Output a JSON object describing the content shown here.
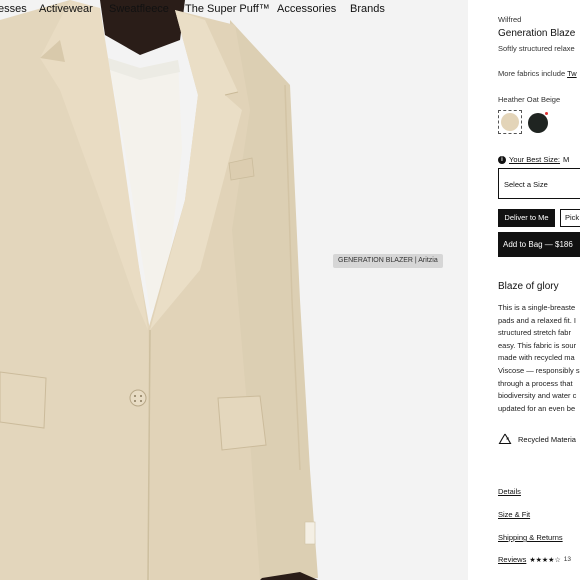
{
  "nav": {
    "items": [
      "esses",
      "Activewear",
      "Sweatfleece",
      "The Super Puff™",
      "Accessories",
      "Brands"
    ]
  },
  "image": {
    "tooltip": "GENERATION BLAZER | Aritzia"
  },
  "product": {
    "brand": "Wilfred",
    "name": "Generation Blaze",
    "subtitle": "Softly structured relaxe",
    "fabrics_prefix": "More fabrics include ",
    "fabrics_link": "Tw",
    "color_name": "Heather Oat Beige",
    "swatches": [
      {
        "name": "Heather Oat Beige",
        "color": "#e3d4b8",
        "selected": true
      },
      {
        "name": "Dark",
        "color": "#1f2421",
        "selected": false
      }
    ],
    "best_size_label": "Your Best Size:",
    "best_size_value": " M",
    "size_select": "Select a Size",
    "deliver_label": "Deliver to Me",
    "pick_label": "Pick",
    "add_to_bag": "Add to Bag — $186"
  },
  "description": {
    "title": "Blaze of glory",
    "lines": [
      "This is a single-breaste",
      "pads and a relaxed fit. I",
      "structured stretch fabr",
      "easy. This fabric is sour",
      "made with recycled ma",
      "Viscose — responsibly s",
      "through a process that",
      "biodiversity and water c",
      "updated for an even be"
    ]
  },
  "recycled": {
    "label": "Recycled Materia"
  },
  "accordion": {
    "details": "Details",
    "size_fit": "Size & Fit",
    "shipping": "Shipping & Returns"
  },
  "reviews": {
    "label": "Reviews",
    "stars": "★★★★☆",
    "count": "13"
  },
  "colors": {
    "accent": "#111111",
    "blazer": "#e3d6bd",
    "background": "#f2f2f2"
  }
}
